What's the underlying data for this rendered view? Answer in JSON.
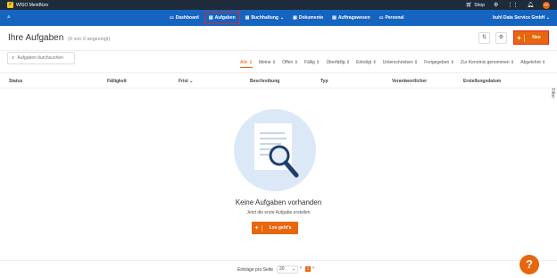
{
  "topbar": {
    "app_name": "WISO MeinBüro",
    "shop": "Shop",
    "user_initials": "PP"
  },
  "nav": {
    "items": [
      {
        "label": "Dashboard",
        "icon": "dashboard-icon"
      },
      {
        "label": "Aufgaben",
        "icon": "tasks-icon"
      },
      {
        "label": "Buchhaltung",
        "icon": "accounting-icon"
      },
      {
        "label": "Dokumente",
        "icon": "documents-icon"
      },
      {
        "label": "Auftragswesen",
        "icon": "orders-icon"
      },
      {
        "label": "Personal",
        "icon": "personnel-icon"
      }
    ],
    "company": "buhl Data Service GmbH"
  },
  "header": {
    "title": "Ihre Aufgaben",
    "subtitle": "(0 von 0 angezeigt)",
    "new_button": "Neu"
  },
  "search": {
    "placeholder": "Aufgaben durchsuchen"
  },
  "filters": [
    "Alle",
    "Meine",
    "Offen",
    "Fällig",
    "Überfällig",
    "Erledigt",
    "Unterschrieben",
    "Freigegeben",
    "Zur Kenntnis genommen",
    "Abgelehnt"
  ],
  "columns": [
    "Status",
    "Fälligkeit",
    "Frist",
    "Beschreibung",
    "Typ",
    "Verantwortlicher",
    "Erstellungsdatum"
  ],
  "side_tab": "Filter",
  "empty": {
    "title": "Keine Aufgaben vorhanden",
    "subtitle": "Jetzt die erste Aufgabe erstellen",
    "button": "Los geht's"
  },
  "footer": {
    "per_page_label": "Einträge pro Seite",
    "per_page_value": "20",
    "current_page": "1"
  },
  "colors": {
    "accent": "#e8660c",
    "nav": "#1565c0",
    "topbar": "#1d2b3a",
    "highlight": "#e0262a"
  }
}
